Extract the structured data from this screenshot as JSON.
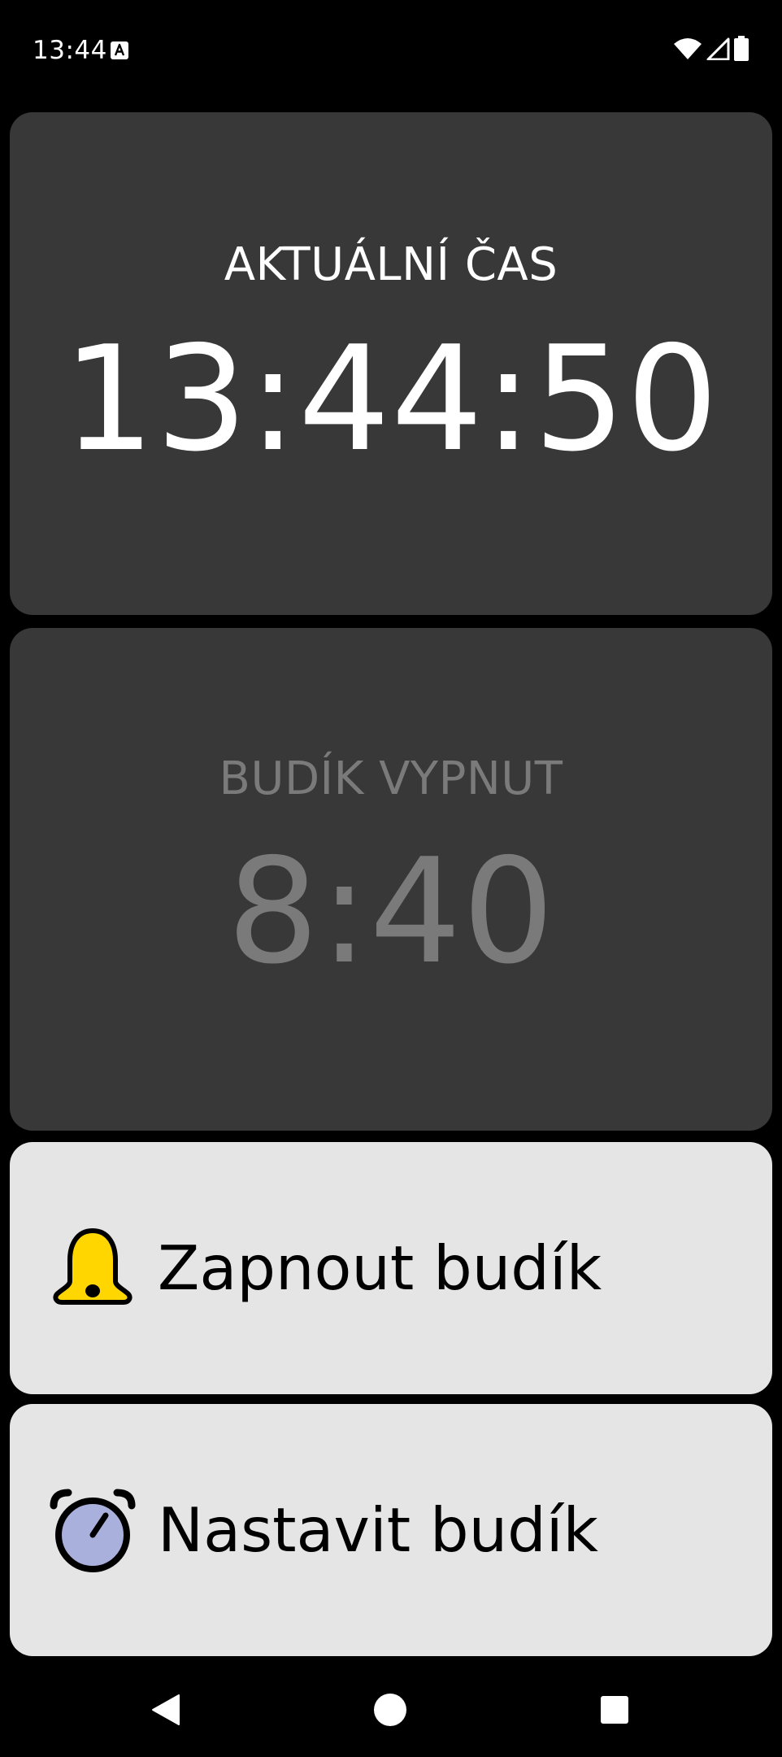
{
  "status_bar": {
    "time": "13:44",
    "icons": [
      "a-notification-icon",
      "wifi-icon",
      "cell-signal-icon",
      "battery-icon"
    ]
  },
  "clock": {
    "caption": "AKTUÁLNÍ ČAS",
    "time": "13:44:50"
  },
  "alarm": {
    "caption": "BUDÍK VYPNUT",
    "time": "8:40"
  },
  "actions": {
    "enable_label": "Zapnout budík",
    "enable_icon": "bell-icon",
    "set_label": "Nastavit budík",
    "set_icon": "alarm-clock-icon"
  },
  "nav_bar": {
    "icons": [
      "back-icon",
      "home-icon",
      "recents-icon"
    ]
  },
  "colors": {
    "background": "#000000",
    "card_dark": "#383838",
    "card_light": "#e5e5e5",
    "text_primary": "#ffffff",
    "text_disabled": "#7a7a7a",
    "bell_yellow": "#ffd600",
    "clock_face": "#aab0dc"
  }
}
